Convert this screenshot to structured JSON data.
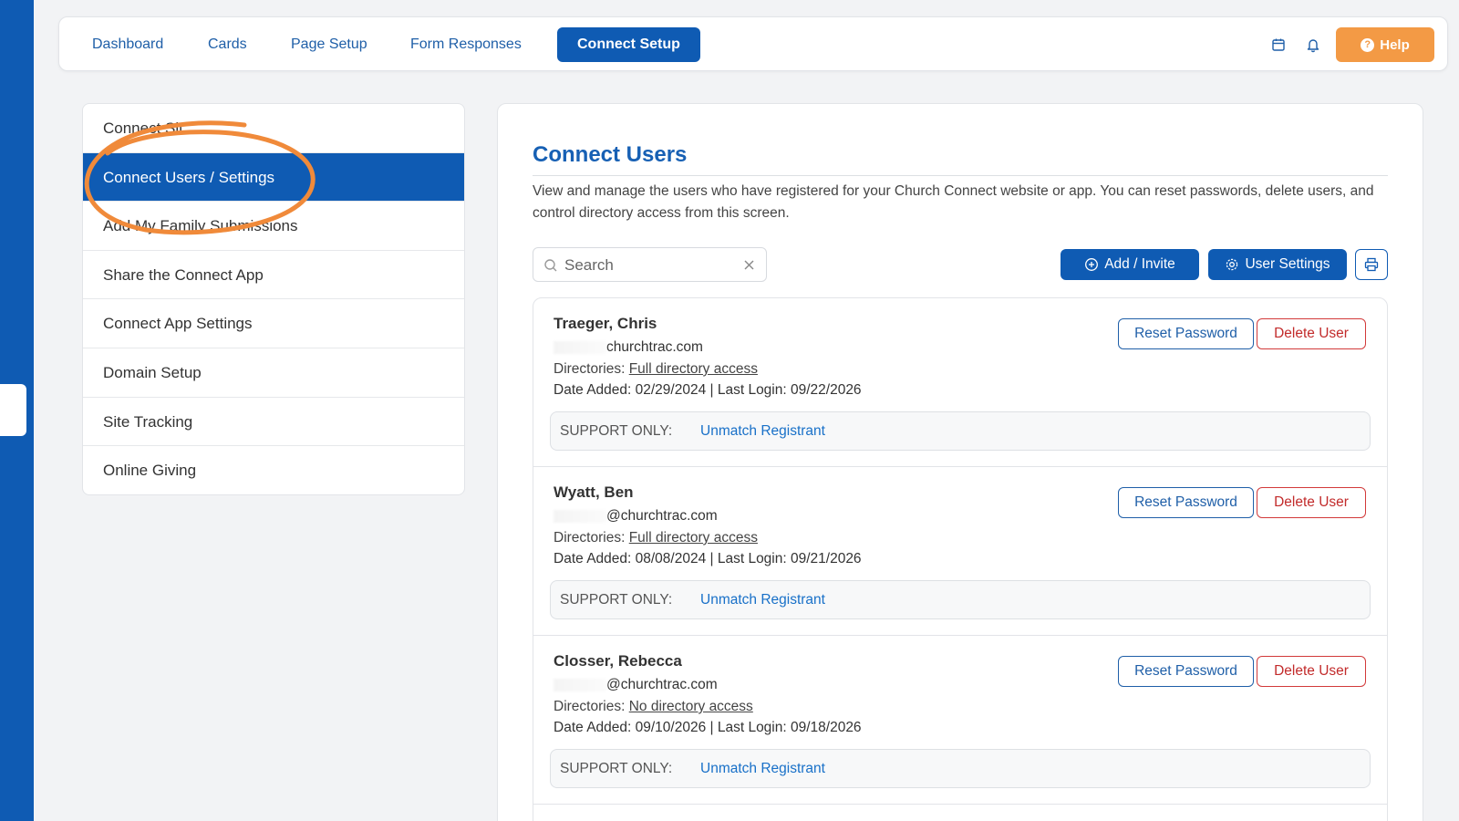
{
  "nav": {
    "items": [
      "Dashboard",
      "Cards",
      "Page Setup",
      "Form Responses",
      "Connect Setup"
    ],
    "active": "Connect Setup",
    "icons": [
      "calendar-icon",
      "bell-icon"
    ],
    "help_label": "Help"
  },
  "sidebar": {
    "items": [
      {
        "label": "Connect Sit..."
      },
      {
        "label": "Connect Users / Settings"
      },
      {
        "label": "Add My Family Submissions"
      },
      {
        "label": "Share the Connect App"
      },
      {
        "label": "Connect App Settings"
      },
      {
        "label": "Domain Setup"
      },
      {
        "label": "Site Tracking"
      },
      {
        "label": "Online Giving"
      }
    ],
    "active_index": 1,
    "annotation_color": "#f08a3a"
  },
  "main": {
    "title": "Connect Users",
    "description": "View and manage the users who have registered for your Church Connect website or app. You can reset passwords, delete users, and control directory access from this screen.",
    "search": {
      "placeholder": "Search",
      "value": ""
    },
    "add_invite_label": "Add / Invite",
    "user_settings_label": "User Settings",
    "users": [
      {
        "name": "Traeger, Chris",
        "email": "churchtrac.com",
        "directories_label": "Directories:",
        "directories_value": "Full directory access",
        "dates": "Date Added: 02/29/2024 | Last Login: 09/22/2026",
        "reset_label": "Reset Password",
        "delete_label": "Delete User",
        "support_label": "SUPPORT ONLY:",
        "support_link": "Unmatch Registrant"
      },
      {
        "name": "Wyatt, Ben",
        "email": "@churchtrac.com",
        "directories_label": "Directories:",
        "directories_value": "Full directory access",
        "dates": "Date Added: 08/08/2024 | Last Login: 09/21/2026",
        "reset_label": "Reset Password",
        "delete_label": "Delete User",
        "support_label": "SUPPORT ONLY:",
        "support_link": "Unmatch Registrant"
      },
      {
        "name": "Closser, Rebecca",
        "email": "@churchtrac.com",
        "directories_label": "Directories:",
        "directories_value": "No directory access",
        "dates": "Date Added: 09/10/2026 | Last Login: 09/18/2026",
        "reset_label": "Reset Password",
        "delete_label": "Delete User",
        "support_label": "SUPPORT ONLY:",
        "support_link": "Unmatch Registrant"
      }
    ]
  },
  "colors": {
    "brand_blue": "#0f5bb3",
    "help_orange": "#f39a45",
    "danger_red": "#d23a3a"
  }
}
